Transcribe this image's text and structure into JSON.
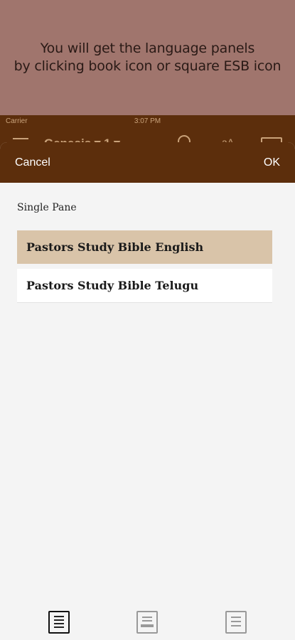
{
  "promo": {
    "line1": "You will get the  language panels",
    "line2": "by clicking book icon or square ESB icon"
  },
  "status_bar": {
    "carrier": "Carrier",
    "time": "3:07 PM"
  },
  "app_bar": {
    "title": "Genesis ▾  1 ▾",
    "font_icon": "aA"
  },
  "sheet": {
    "cancel_label": "Cancel",
    "ok_label": "OK",
    "section_label": "Single Pane",
    "options": [
      {
        "label": "Pastors Study Bible English",
        "selected": true
      },
      {
        "label": "Pastors Study Bible Telugu",
        "selected": false
      }
    ],
    "bottom_icons": [
      "single-pane-icon",
      "double-pane-icon",
      "triple-pane-icon"
    ]
  },
  "colors": {
    "promo_bg": "#a0756d",
    "header_brown": "#5c2e0c",
    "selected_bg": "#d9c4a9",
    "sheet_bg": "#f4f4f4"
  }
}
